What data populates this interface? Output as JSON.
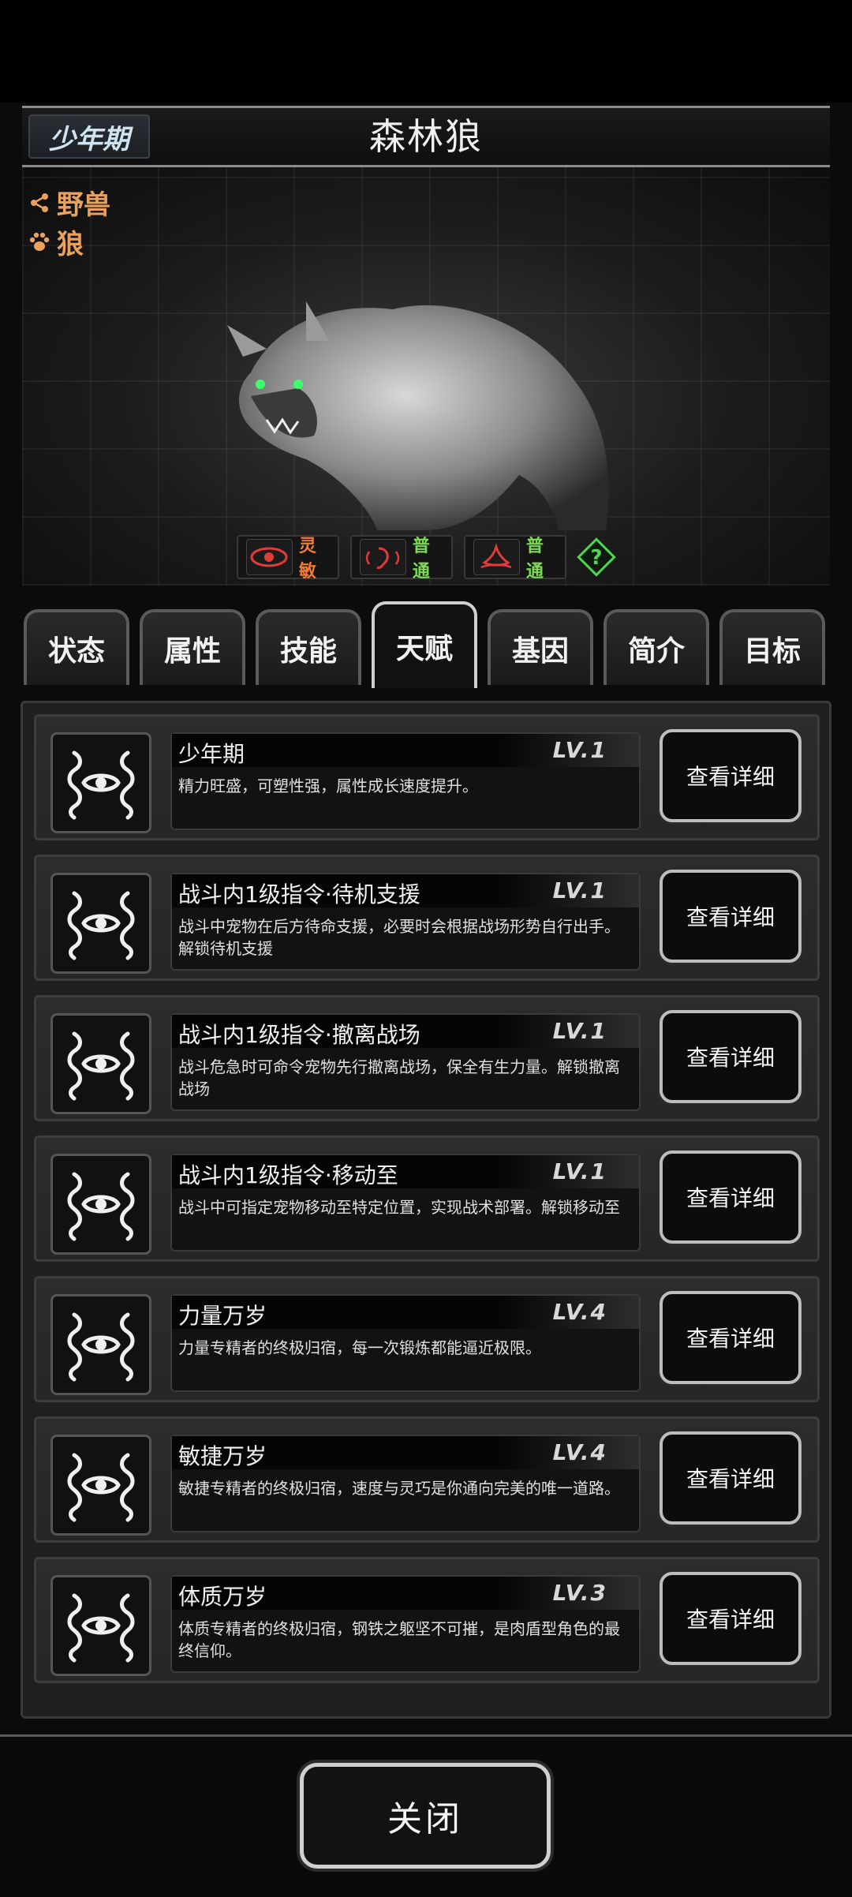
{
  "header": {
    "stage": "少年期",
    "name": "森林狼"
  },
  "tags": {
    "category": "野兽",
    "species": "狼"
  },
  "traits": [
    {
      "icon": "eye-icon",
      "value": "灵敏",
      "color": "#f07a3a"
    },
    {
      "icon": "ear-icon",
      "value": "普通",
      "color": "#7ed957"
    },
    {
      "icon": "nose-icon",
      "value": "普通",
      "color": "#7ed957"
    }
  ],
  "tabs": [
    {
      "label": "状态",
      "active": false
    },
    {
      "label": "属性",
      "active": false
    },
    {
      "label": "技能",
      "active": false
    },
    {
      "label": "天赋",
      "active": true
    },
    {
      "label": "基因",
      "active": false
    },
    {
      "label": "简介",
      "active": false
    },
    {
      "label": "目标",
      "active": false
    }
  ],
  "talents": [
    {
      "title": "少年期",
      "level": "LV.1",
      "desc": "精力旺盛，可塑性强，属性成长速度提升。",
      "button": "查看详细"
    },
    {
      "title": "战斗内1级指令·待机支援",
      "level": "LV.1",
      "desc": "战斗中宠物在后方待命支援，必要时会根据战场形势自行出手。解锁待机支援",
      "button": "查看详细"
    },
    {
      "title": "战斗内1级指令·撤离战场",
      "level": "LV.1",
      "desc": "战斗危急时可命令宠物先行撤离战场，保全有生力量。解锁撤离战场",
      "button": "查看详细"
    },
    {
      "title": "战斗内1级指令·移动至",
      "level": "LV.1",
      "desc": "战斗中可指定宠物移动至特定位置，实现战术部署。解锁移动至",
      "button": "查看详细"
    },
    {
      "title": "力量万岁",
      "level": "LV.4",
      "desc": "力量专精者的终极归宿，每一次锻炼都能逼近极限。",
      "button": "查看详细"
    },
    {
      "title": "敏捷万岁",
      "level": "LV.4",
      "desc": "敏捷专精者的终极归宿，速度与灵巧是你通向完美的唯一道路。",
      "button": "查看详细"
    },
    {
      "title": "体质万岁",
      "level": "LV.3",
      "desc": "体质专精者的终极归宿，钢铁之躯坚不可摧，是肉盾型角色的最终信仰。",
      "button": "查看详细"
    }
  ],
  "footer": {
    "close_label": "关闭"
  }
}
